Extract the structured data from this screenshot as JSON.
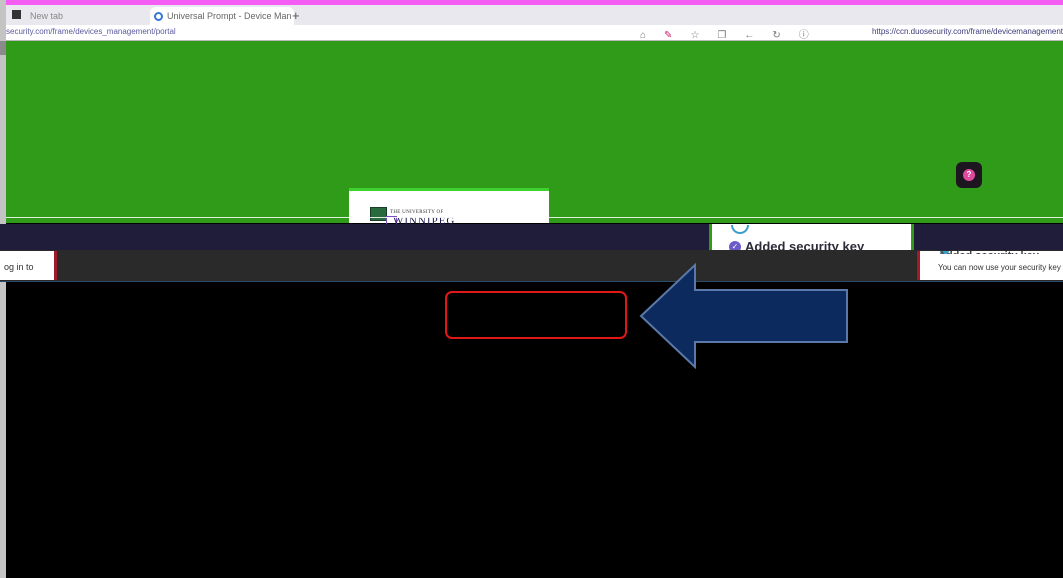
{
  "browser": {
    "tabs": [
      {
        "label": "New tab",
        "active": false
      },
      {
        "label": "Universal Prompt - Device Man",
        "active": true
      }
    ],
    "new_tab_glyph": "+",
    "close_glyph": "×",
    "url_left": "security.com/frame/devices_management/portal",
    "url_right": "https://ccn.duosecurity.com/frame/devicemanagement",
    "colors": {
      "accent_band": "#f35df3",
      "tab_bar": "#e8e8ee"
    }
  },
  "page": {
    "background_color": "#2f9b19",
    "chat_icon": "chat-bubble-icon",
    "university": {
      "small_text": "THE UNIVERSITY OF",
      "name": "WINNIPEG"
    },
    "added_key_title": "Added security key",
    "login_text": "og in to",
    "right_panel_text": "You can now use your security key t",
    "right_panel_title": "Added security key"
  },
  "annotations": {
    "highlight_box_color": "#e01818",
    "arrow_color": "#0c2a5e",
    "arrow_direction": "left"
  }
}
